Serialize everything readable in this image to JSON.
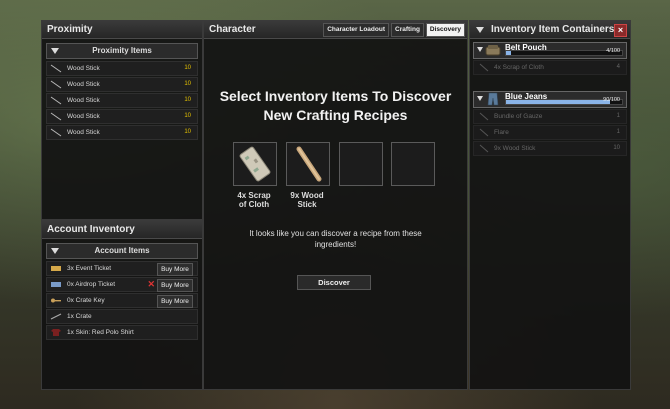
{
  "proximity": {
    "title": "Proximity",
    "section": "Proximity Items",
    "items": [
      {
        "label": "Wood Stick",
        "count": "10"
      },
      {
        "label": "Wood Stick",
        "count": "10"
      },
      {
        "label": "Wood Stick",
        "count": "10"
      },
      {
        "label": "Wood Stick",
        "count": "10"
      },
      {
        "label": "Wood Stick",
        "count": "10"
      }
    ]
  },
  "account": {
    "title": "Account Inventory",
    "section": "Account Items",
    "buy_label": "Buy More",
    "items": [
      {
        "label": "3x  Event Ticket",
        "icon": "ticket-icon"
      },
      {
        "label": "0x  Airdrop Ticket",
        "icon": "airdrop-ticket-icon"
      },
      {
        "label": "0x  Crate Key",
        "icon": "key-icon"
      },
      {
        "label": "1x  Crate",
        "icon": "crate-icon"
      },
      {
        "label": "1x  Skin: Red Polo Shirt",
        "icon": "shirt-icon"
      }
    ]
  },
  "character": {
    "title": "Character",
    "tabs": [
      "Character Loadout",
      "Crafting",
      "Discovery"
    ],
    "active_tab": "Discovery",
    "heading_line1": "Select Inventory Items To Discover",
    "heading_line2": "New Crafting Recipes",
    "slots": [
      {
        "line1": "4x  Scrap",
        "line2": "of Cloth",
        "icon": "scrap-cloth-icon"
      },
      {
        "line1": "9x  Wood",
        "line2": "Stick",
        "icon": "wood-stick-icon"
      },
      {
        "line1": "",
        "line2": ""
      },
      {
        "line1": "",
        "line2": ""
      }
    ],
    "message_line1": "It looks like you can discover a recipe from these",
    "message_line2": "ingredients!",
    "discover_label": "Discover"
  },
  "containers": {
    "title": "Inventory Item Containers",
    "belt": {
      "name": "Belt Pouch",
      "capacity": "4/100",
      "fill_percent": 4,
      "items": [
        {
          "label": "4x  Scrap of Cloth",
          "count": "4"
        }
      ]
    },
    "jeans": {
      "name": "Blue Jeans",
      "capacity": "90/100",
      "fill_percent": 90,
      "items": [
        {
          "label": "Bundle of Gauze",
          "count": "1"
        },
        {
          "label": "Flare",
          "count": "1"
        },
        {
          "label": "9x  Wood Stick",
          "count": "10"
        }
      ]
    }
  },
  "colors": {
    "accent_yellow": "#e6c200",
    "capacity_bar": "#8ab4e8",
    "close_button": "#8a2a2a"
  }
}
